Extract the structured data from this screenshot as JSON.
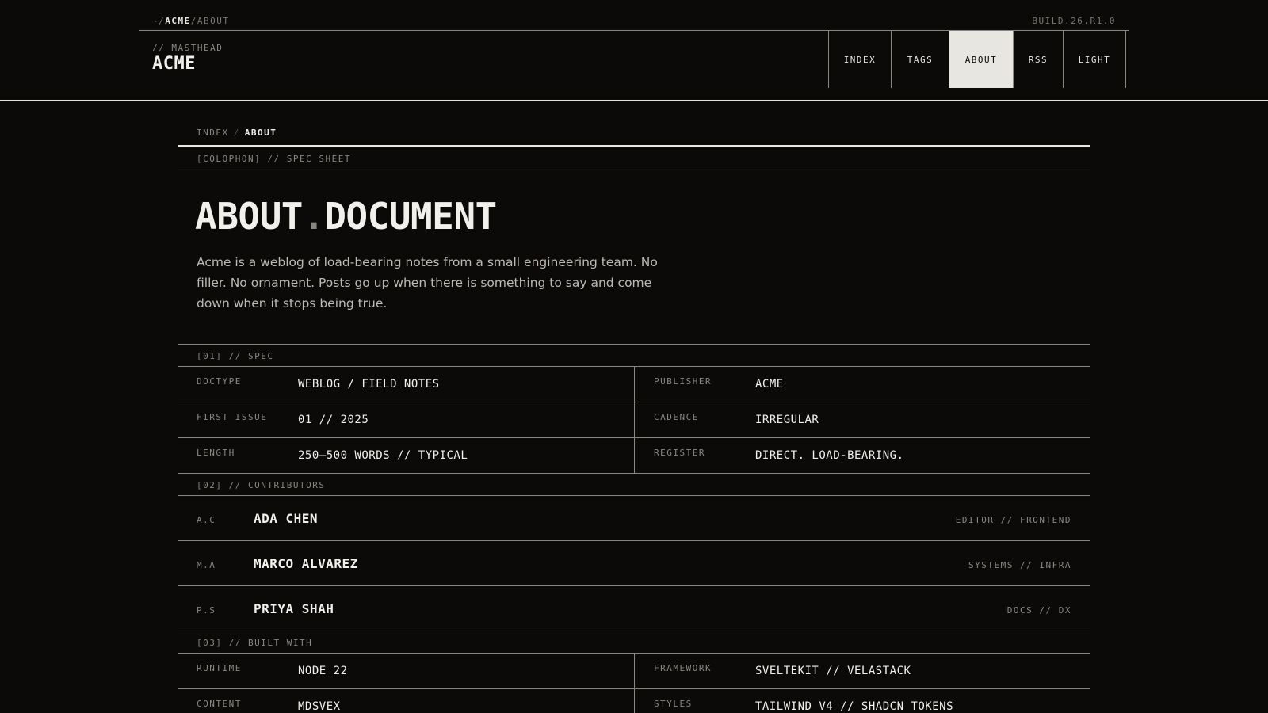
{
  "topbar": {
    "path_prefix": "~/",
    "path_site": "ACME",
    "path_sep": "/",
    "path_page": "ABOUT",
    "build": "BUILD.26.R1.0"
  },
  "masthead": {
    "label": "// MASTHEAD",
    "title": "ACME"
  },
  "nav": {
    "items": [
      {
        "label": "INDEX",
        "active": false
      },
      {
        "label": "TAGS",
        "active": false
      },
      {
        "label": "ABOUT",
        "active": true
      },
      {
        "label": "RSS",
        "active": false
      },
      {
        "label": "LIGHT",
        "active": false
      }
    ]
  },
  "breadcrumb": {
    "root": "INDEX",
    "sep": "/",
    "current": "ABOUT"
  },
  "colophon": "[COLOPHON] // SPEC SHEET",
  "page": {
    "title_left": "ABOUT",
    "title_dot": ".",
    "title_right": "DOCUMENT",
    "lede": "Acme is a weblog of load-bearing notes from a small engineering team. No filler. No ornament. Posts go up when there is something to say and come down when it stops being true."
  },
  "spec": {
    "label": "[01] // SPEC",
    "rows": [
      {
        "k1": "DOCTYPE",
        "v1": "WEBLOG / FIELD NOTES",
        "k2": "PUBLISHER",
        "v2": "ACME"
      },
      {
        "k1": "FIRST ISSUE",
        "v1": "01 // 2025",
        "k2": "CADENCE",
        "v2": "IRREGULAR"
      },
      {
        "k1": "LENGTH",
        "v1": "250–500 WORDS // TYPICAL",
        "k2": "REGISTER",
        "v2": "DIRECT. LOAD-BEARING."
      }
    ]
  },
  "contributors": {
    "label": "[02] // CONTRIBUTORS",
    "people": [
      {
        "initials": "A.C",
        "name": "ADA CHEN",
        "role": "EDITOR // FRONTEND"
      },
      {
        "initials": "M.A",
        "name": "MARCO ALVAREZ",
        "role": "SYSTEMS // INFRA"
      },
      {
        "initials": "P.S",
        "name": "PRIYA SHAH",
        "role": "DOCS // DX"
      }
    ]
  },
  "built_with": {
    "label": "[03] // BUILT WITH",
    "rows": [
      {
        "k1": "RUNTIME",
        "v1": "NODE 22",
        "k2": "FRAMEWORK",
        "v2": "SVELTEKIT // VELASTACK"
      },
      {
        "k1": "CONTENT",
        "v1": "MDSVEX",
        "k2": "STYLES",
        "v2": "TAILWIND V4 // SHADCN TOKENS"
      }
    ]
  }
}
